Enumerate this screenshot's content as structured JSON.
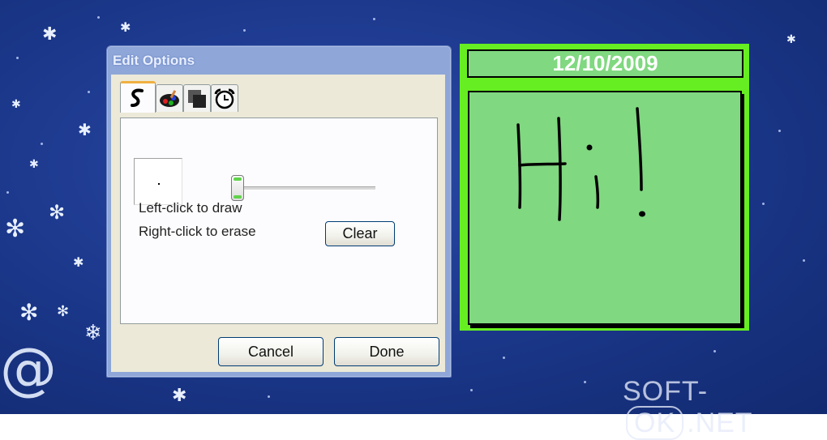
{
  "dialog": {
    "title": "Edit Options",
    "tabs": [
      {
        "icon": "pen-stroke-icon",
        "active": true
      },
      {
        "icon": "palette-icon",
        "active": false
      },
      {
        "icon": "background-layers-icon",
        "active": false
      },
      {
        "icon": "alarm-clock-icon",
        "active": false
      }
    ],
    "pen_size_level": 0.0,
    "hint_draw": "Left-click to draw",
    "hint_erase": "Right-click to erase",
    "clear_label": "Clear",
    "cancel_label": "Cancel",
    "done_label": "Done"
  },
  "note": {
    "date": "12/10/2009",
    "handwriting": "Hi!",
    "colors": {
      "frame": "#66ee22",
      "paper": "#80d880",
      "ink": "#000000"
    }
  },
  "watermark": {
    "left": "SOFT-",
    "middle": "OK",
    "right": ".NET"
  },
  "colors": {
    "desktop": "#1a3688",
    "dialog_frame": "#8ea6d8",
    "dialog_body": "#ece9d8"
  }
}
